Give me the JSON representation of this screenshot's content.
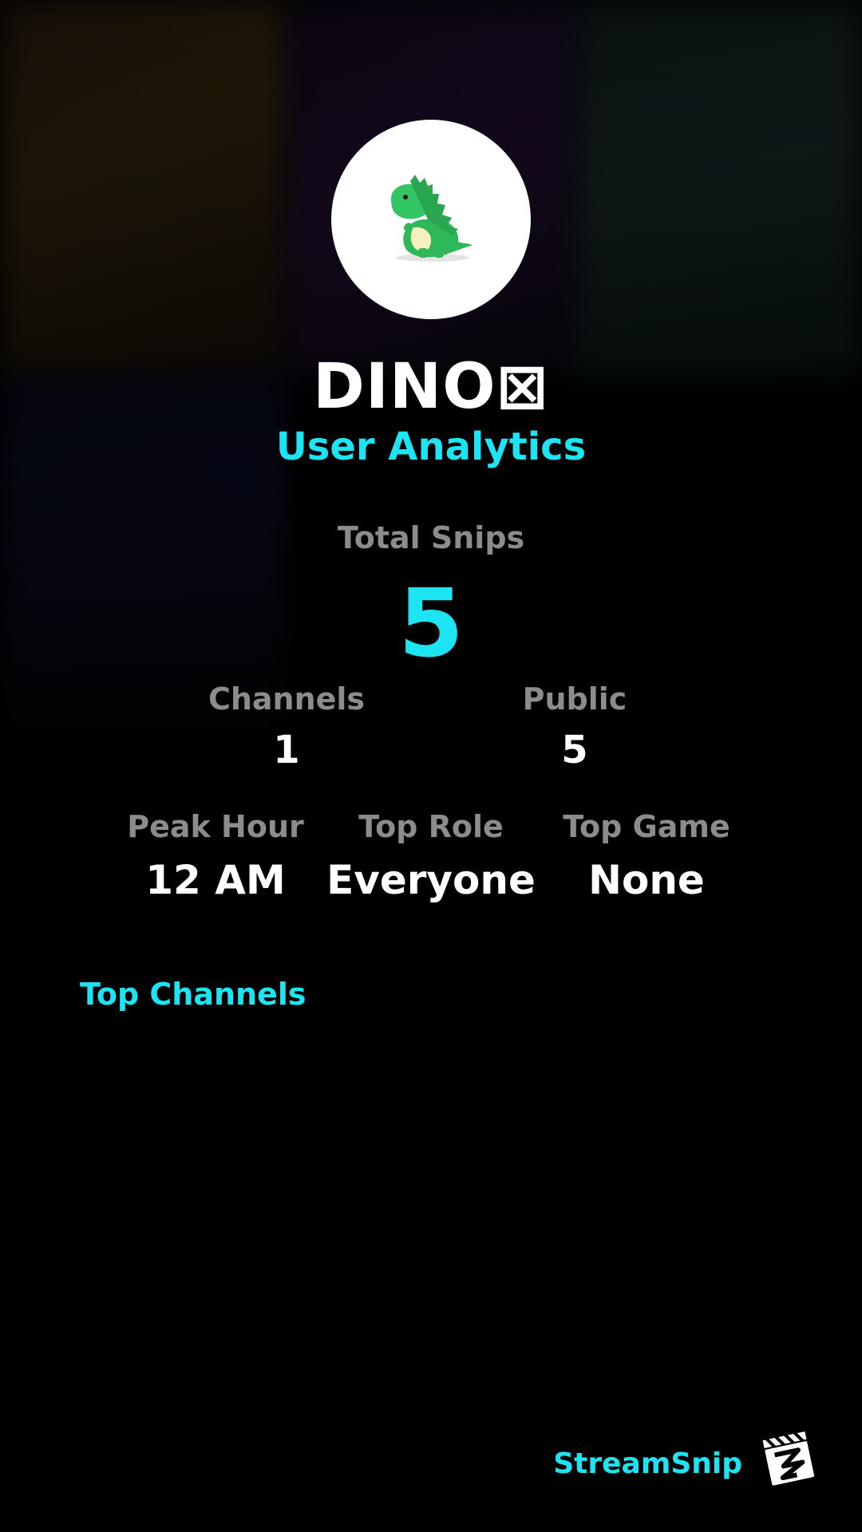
{
  "profile": {
    "username": "DINO⊠",
    "subtitle": "User Analytics",
    "avatar_icon": "dinosaur-icon"
  },
  "stats": {
    "total_snips": {
      "label": "Total Snips",
      "value": "5"
    },
    "channels": {
      "label": "Channels",
      "value": "1"
    },
    "public": {
      "label": "Public",
      "value": "5"
    },
    "peak_hour": {
      "label": "Peak Hour",
      "value": "12 AM"
    },
    "top_role": {
      "label": "Top Role",
      "value": "Everyone"
    },
    "top_game": {
      "label": "Top Game",
      "value": "None"
    }
  },
  "sections": {
    "top_channels_title": "Top Channels"
  },
  "brand": {
    "name": "StreamSnip",
    "logo_icon": "clapperboard-icon"
  },
  "colors": {
    "accent": "#1de4f2",
    "label_gray": "#8c8c8c",
    "background": "#000000",
    "text": "#ffffff"
  }
}
